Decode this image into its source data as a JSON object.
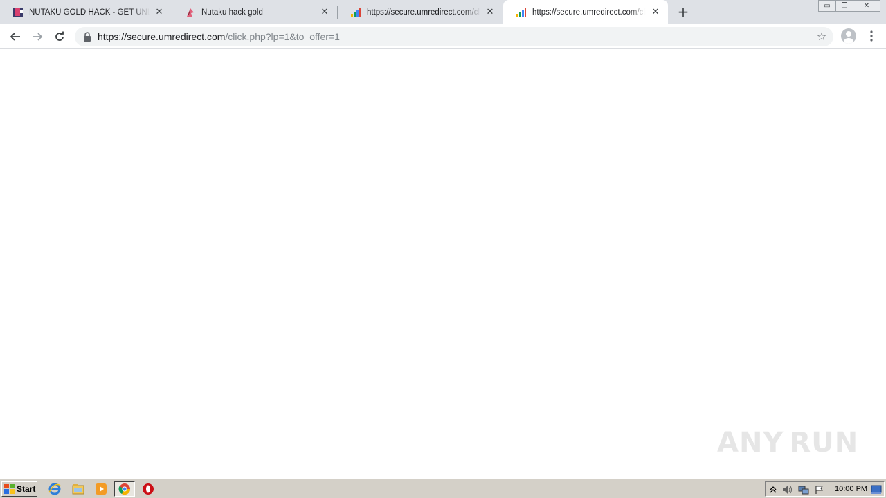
{
  "browser": {
    "tabs": [
      {
        "title": "NUTAKU GOLD HACK - GET UNLIMITED",
        "icon": "nutaku-favicon",
        "active": false
      },
      {
        "title": "Nutaku hack gold",
        "icon": "pink-feather-favicon",
        "active": false
      },
      {
        "title": "https://secure.umredirect.com/click.php",
        "icon": "bar-chart-favicon",
        "active": false
      },
      {
        "title": "https://secure.umredirect.com/click.php",
        "icon": "bar-chart-favicon",
        "active": true
      }
    ],
    "close_glyph": "✕",
    "new_tab_glyph": "+",
    "address": {
      "host": "https://secure.umredirect.com",
      "path": "/click.php?lp=1&to_offer=1"
    },
    "star_glyph": "☆"
  },
  "window_controls": {
    "minimize": "▭",
    "restore": "❐",
    "close": "✕"
  },
  "watermark": {
    "left": "ANY",
    "right": "RUN"
  },
  "taskbar": {
    "start_label": "Start",
    "pinned": [
      "internet-explorer-icon",
      "file-explorer-icon",
      "media-player-icon",
      "chrome-icon",
      "opera-icon"
    ],
    "clock": "10:00 PM"
  },
  "colors": {
    "tab_strip": "#dee1e6",
    "omnibox": "#f1f3f4",
    "taskbar": "#d4d0c8"
  }
}
